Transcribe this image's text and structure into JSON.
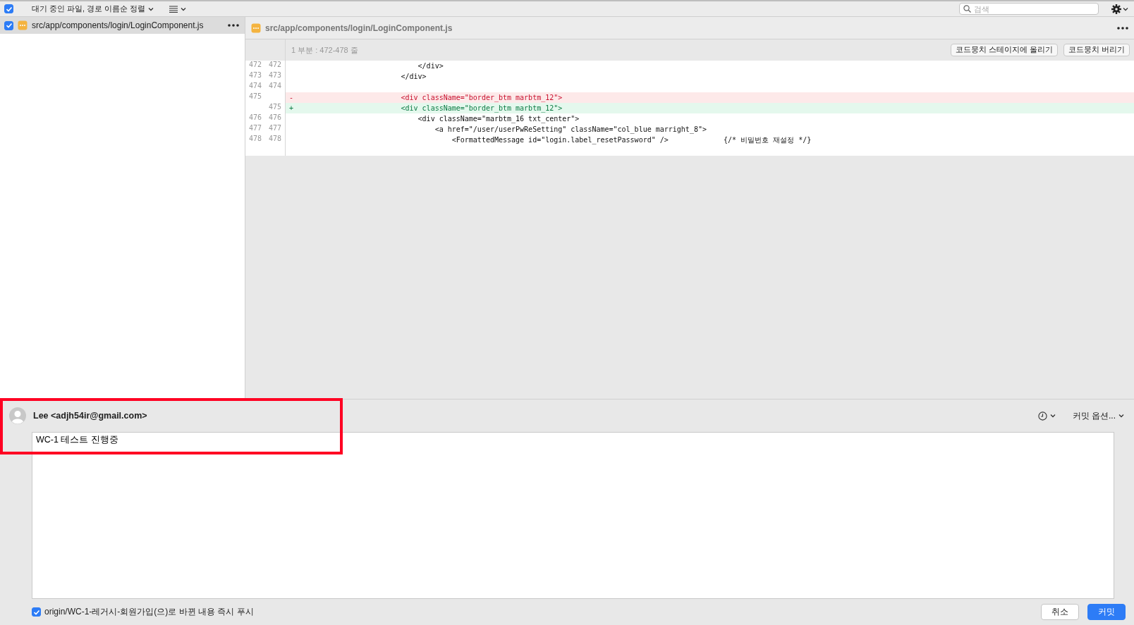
{
  "toolbar": {
    "select_all_checked": true,
    "sort_label": "대기 중인 파일, 경로 이름순 정렬",
    "search": {
      "placeholder": "검색"
    }
  },
  "files": [
    {
      "path": "src/app/components/login/LoginComponent.js",
      "checked": true,
      "selected": true
    }
  ],
  "diff": {
    "file_path": "src/app/components/login/LoginComponent.js",
    "hunk_header": "1 부분 : 472-478 줄",
    "buttons": [
      "코드뭉치 스테이지에 올리기",
      "코드뭉치 버리기"
    ],
    "lines": [
      {
        "old": "472",
        "new": "472",
        "kind": "context",
        "text": "                            </div>"
      },
      {
        "old": "473",
        "new": "473",
        "kind": "context",
        "text": "                        </div>"
      },
      {
        "old": "474",
        "new": "474",
        "kind": "context"
      },
      {
        "old": "475",
        "kind": "removed",
        "marker": "-",
        "text": "                        <div className=\"border_btm marbtm_12\">"
      },
      {
        "new": "475",
        "kind": "added",
        "marker": "+",
        "text": "                        <div className=\"border_btm marbtm_12\">"
      },
      {
        "old": "476",
        "new": "476",
        "kind": "context",
        "text": "                            <div className=\"marbtm_16 txt_center\">"
      },
      {
        "old": "477",
        "new": "477",
        "kind": "context",
        "text": "                                <a href=\"/user/userPwReSetting\" className=\"col_blue marright_8\">"
      },
      {
        "old": "478",
        "new": "478",
        "kind": "context",
        "text": "                                    <FormattedMessage id=\"login.label_resetPassword\" />             {/* 비밀번호 재설정 */}"
      }
    ]
  },
  "commit": {
    "author": "Lee <adjh54ir@gmail.com>",
    "options_label": "커밋 옵션...",
    "message": "WC-1 테스트 진행중",
    "push": {
      "checked": true,
      "label": "origin/WC-1-레거시-회원가입(으)로 바뀐 내용 즉시 푸시"
    },
    "buttons": [
      {
        "label": "취소",
        "primary": false
      },
      {
        "label": "커밋",
        "primary": true
      }
    ]
  },
  "annotations": [
    {
      "kind": "rectangle"
    }
  ]
}
